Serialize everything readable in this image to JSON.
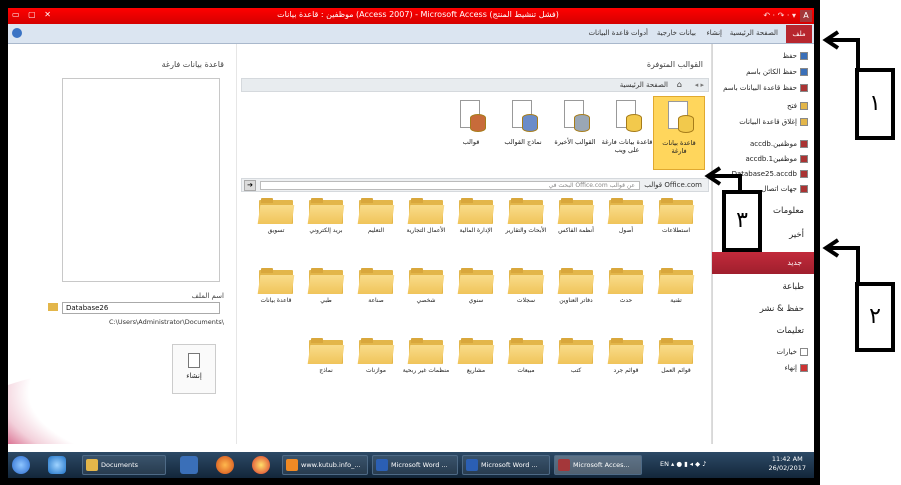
{
  "window": {
    "title": "موظفين : قاعدة بيانات (Access 2007) - Microsoft Access (فشل تنشيط المنتج)",
    "app_icon": "A",
    "qat": "↶ · ↷ · ▾"
  },
  "ribbon": {
    "tabs": [
      "ملف",
      "الصفحة الرئيسية",
      "إنشاء",
      "بيانات خارجية",
      "أدوات قاعدة البيانات"
    ]
  },
  "nav": {
    "items": [
      "حفظ",
      "حفظ الكائن باسم",
      "حفظ قاعدة البيانات باسم",
      "فتح",
      "إغلاق قاعدة البيانات",
      "موظفين.accdb",
      "موظفين1.accdb",
      "Database25.accdb",
      "جهات اتصال"
    ],
    "info": "معلومات",
    "recent": "أخير",
    "new": "جديد",
    "print": "طباعة",
    "save_publish": "حفظ & نشر",
    "help": "تعليمات",
    "options": "خيارات",
    "exit": "إنهاء"
  },
  "templates": {
    "title": "القوالب المتوفرة",
    "home": "الصفحة الرئيسية",
    "top_tiles": [
      {
        "label": "قاعدة بيانات فارغة",
        "icon": "blank-database-icon",
        "selected": true
      },
      {
        "label": "قاعدة بيانات فارغة على ويب",
        "icon": "web-database-icon"
      },
      {
        "label": "القوالب الأخيرة",
        "icon": "recent-templates-icon"
      },
      {
        "label": "نماذج القوالب",
        "icon": "sample-templates-icon"
      },
      {
        "label": "قوالب",
        "icon": "my-templates-icon"
      }
    ],
    "office_caption": "قوالب Office.com",
    "search_placeholder": "البحث في Office.com عن قوالب",
    "search_go": "➔",
    "folders_row1": [
      "استطلاعات",
      "أصول",
      "أنظمة الفاكس",
      "الأبحاث والتقارير",
      "الإدارة المالية",
      "الأعمال التجارية",
      "التعليم",
      "بريد إلكتروني",
      "تسويق"
    ],
    "folders_row2": [
      "تقنية",
      "حدث",
      "دفاتر العناوين",
      "سجلات",
      "سنوي",
      "شخصي",
      "صناعة",
      "طبي",
      "قاعدة بيانات"
    ],
    "folders_row3": [
      "قوائم العمل",
      "قوائم جرد",
      "كتب",
      "مبيعات",
      "مشاريع",
      "منظمات غير ربحية",
      "موازنات",
      "نماذج"
    ]
  },
  "blank_db": {
    "title": "قاعدة بيانات فارغة",
    "file_name_label": "اسم الملف",
    "file_name": "Database26",
    "path": "C:\\Users\\Administrator\\Documents\\",
    "create_label": "إنشاء"
  },
  "taskbar": {
    "buttons": [
      "Documents",
      "www.kutub.info_...",
      "Microsoft Word ...",
      "Microsoft Word ...",
      "Microsoft Acces..."
    ],
    "lang": "EN",
    "time": "11:42 AM",
    "date": "26/02/2017"
  },
  "annotations": {
    "box1": "١",
    "box2": "٢",
    "box3": "٣"
  }
}
